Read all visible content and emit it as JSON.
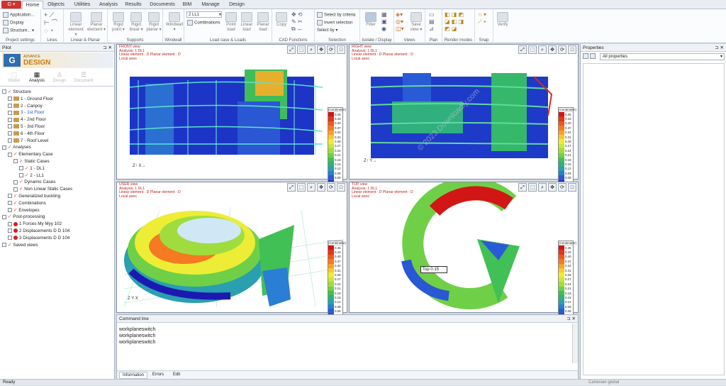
{
  "app_menu_label": "G",
  "tabs": [
    "Home",
    "Objects",
    "Utilities",
    "Analysis",
    "Results",
    "Documents",
    "BIM",
    "Manage",
    "Design"
  ],
  "ribbon": {
    "project_settings": {
      "label": "Project settings",
      "items": [
        "Application...",
        "Display",
        "Structure..."
      ]
    },
    "lines": {
      "label": "Lines"
    },
    "linear_planar": {
      "label": "Linear & Planar",
      "buttons": [
        "Linear element",
        "Planar element"
      ]
    },
    "supports": {
      "label": "Supports",
      "buttons": [
        "Rigid point",
        "Rigid linear",
        "Rigid planar"
      ]
    },
    "windwall": {
      "label": "Windwall",
      "buttons": [
        "Windwall"
      ]
    },
    "load_case": {
      "label": "Load case & Loads",
      "combo": "2 LL1",
      "combinations": "Combinations",
      "buttons": [
        "Point load",
        "Linear load",
        "Planar load"
      ]
    },
    "cad": {
      "label": "CAD Functions",
      "buttons": [
        "Copy"
      ]
    },
    "selection": {
      "label": "Selection",
      "items": [
        "Select by criteria",
        "Invert selection",
        "Select by"
      ]
    },
    "isolate": {
      "label": "Isolate / Display",
      "buttons": [
        "Filter"
      ]
    },
    "views": {
      "label": "Views",
      "buttons": [
        "Save view"
      ]
    },
    "plan": {
      "label": "Plan"
    },
    "render": {
      "label": "Render modes"
    },
    "snap": {
      "label": "Snap"
    },
    "verify": {
      "label": "Verify"
    }
  },
  "pilot": {
    "title": "Pilot",
    "logo_small": "ADVANCE",
    "logo_big": "DESIGN",
    "modes": [
      "Model",
      "Analysis",
      "Design",
      "Document"
    ],
    "tree": [
      {
        "label": "Structure",
        "level": 0,
        "kind": "check"
      },
      {
        "label": "1 - Ground Floor",
        "level": 1,
        "kind": "folder"
      },
      {
        "label": "2 - Canpoy",
        "level": 1,
        "kind": "folder"
      },
      {
        "label": "3 - 1st Floor",
        "level": 1,
        "kind": "folder",
        "highlight": true
      },
      {
        "label": "4 - 2nd Floor",
        "level": 1,
        "kind": "folder"
      },
      {
        "label": "5 - 3rd Floor",
        "level": 1,
        "kind": "folder"
      },
      {
        "label": "6 - 4th Floor",
        "level": 1,
        "kind": "folder"
      },
      {
        "label": "7 - Roof Level",
        "level": 1,
        "kind": "folder"
      },
      {
        "label": "Analyses",
        "level": 0,
        "kind": "box"
      },
      {
        "label": "Elementary Case",
        "level": 1,
        "kind": "check"
      },
      {
        "label": "Static Cases",
        "level": 2,
        "kind": "check"
      },
      {
        "label": "1 - DL1",
        "level": 3,
        "kind": "check"
      },
      {
        "label": "2 - LL1",
        "level": 3,
        "kind": "check"
      },
      {
        "label": "Dynamic Cases",
        "level": 2,
        "kind": "check"
      },
      {
        "label": "Non Linear Static Cases",
        "level": 2,
        "kind": "check"
      },
      {
        "label": "Generalized buckling",
        "level": 1,
        "kind": "check"
      },
      {
        "label": "Combinations",
        "level": 1,
        "kind": "check"
      },
      {
        "label": "Envelopes",
        "level": 1,
        "kind": "check"
      },
      {
        "label": "Post-processing",
        "level": 0,
        "kind": "check"
      },
      {
        "label": "1 Forces My  Myy  102",
        "level": 1,
        "kind": "dot"
      },
      {
        "label": "2 Displacements D  D  104",
        "level": 1,
        "kind": "dot"
      },
      {
        "label": "3 Displacements D  D  104",
        "level": 1,
        "kind": "dot"
      },
      {
        "label": "Saved views",
        "level": 0,
        "kind": "check"
      }
    ]
  },
  "viewports": [
    {
      "name": "FRONT view",
      "lines": [
        "FRONT view",
        "Analysis: 1  DL1",
        "Linear element : D Planar element : D",
        "Local axes"
      ]
    },
    {
      "name": "RIGHT view",
      "lines": [
        "RIGHT view",
        "Analysis: 1  DL1",
        "Linear element : D Planar element : D",
        "Local axes"
      ]
    },
    {
      "name": "USER view",
      "lines": [
        "USER view",
        "Analysis: 1  DL1",
        "Linear element : D Planar element : D",
        "Local axes"
      ]
    },
    {
      "name": "TOP view",
      "lines": [
        "TOP view",
        "Analysis: 1  DL1",
        "Linear element : D Planar element : D",
        "Local axes"
      ]
    }
  ],
  "legend": {
    "title": "(Centimeter)",
    "values": [
      "0.45",
      "0.43",
      "0.40",
      "0.37",
      "0.34",
      "0.31",
      "0.28",
      "0.27",
      "0.24",
      "0.21",
      "0.18",
      "0.15",
      "0.12",
      "0.09",
      "0.06",
      "0.03",
      "0.00"
    ],
    "colors": [
      "#d21616",
      "#e5351b",
      "#f0561e",
      "#f57a22",
      "#f9a227",
      "#f8c92f",
      "#eded35",
      "#c8e83a",
      "#9fdd3f",
      "#6fd048",
      "#41c055",
      "#2fb07d",
      "#2a9fb0",
      "#2a7ed3",
      "#2a5bd6",
      "#2438c8",
      "#1a1ab0"
    ]
  },
  "top_view_tooltip": "Top 0.15",
  "watermark": "© 2023 Downloadly.com",
  "command": {
    "title": "Command line",
    "lines": [
      "workplaneswitch",
      "workplaneswitch",
      "workplaneswitch"
    ],
    "tabs": [
      "Information",
      "Errors",
      "Edit"
    ]
  },
  "properties": {
    "title": "Properties",
    "filter": "All properties"
  },
  "status": {
    "left": "Ready",
    "coords": "Cartesian global"
  }
}
